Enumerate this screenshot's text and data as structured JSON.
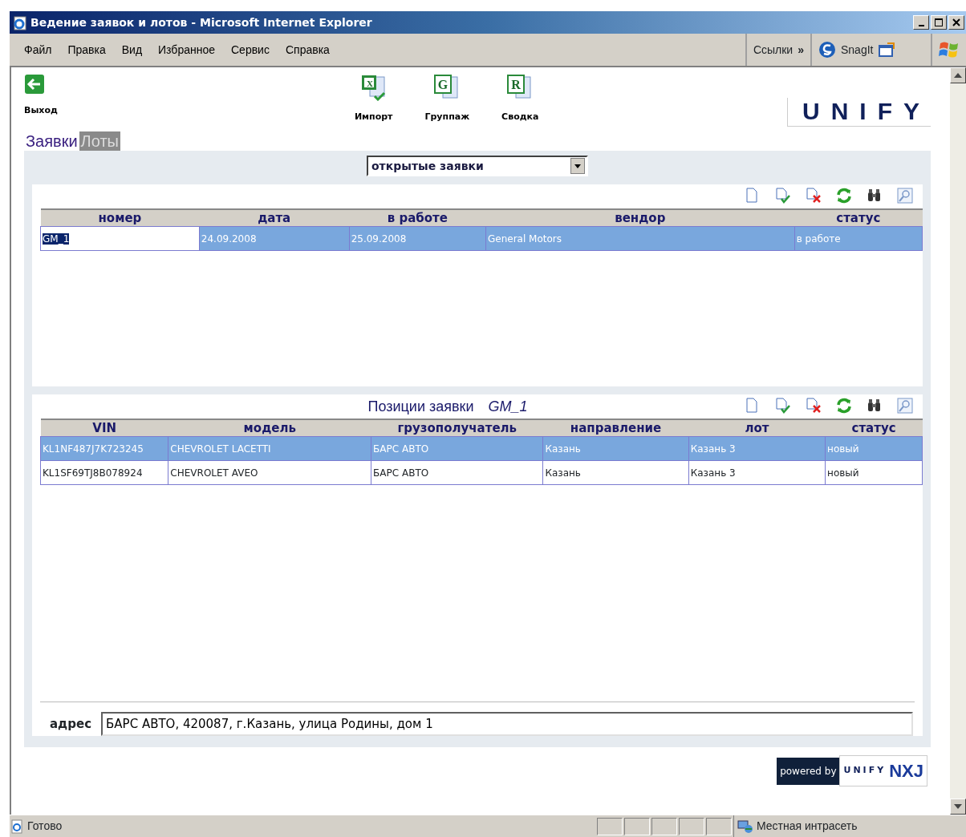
{
  "window": {
    "title": "Ведение заявок и лотов - Microsoft Internet Explorer"
  },
  "menu": [
    "Файл",
    "Правка",
    "Вид",
    "Избранное",
    "Сервис",
    "Справка"
  ],
  "links_bar": {
    "label": "Ссылки",
    "chevron": "»",
    "snagit": "SnagIt"
  },
  "exit_button": {
    "label": "Выход"
  },
  "toolbar": [
    {
      "kind": "excel",
      "label": "Импорт",
      "letter": "X"
    },
    {
      "kind": "doc",
      "label": "Группаж",
      "letter": "G"
    },
    {
      "kind": "doc",
      "label": "Сводка",
      "letter": "R"
    }
  ],
  "logo": "UNIFY",
  "tabs": [
    {
      "label": "Заявки",
      "selected": true
    },
    {
      "label": "Лоты",
      "selected": false
    }
  ],
  "filter": {
    "value": "открытые заявки"
  },
  "orders": {
    "columns": [
      "номер",
      "дата",
      "в работе",
      "вендор",
      "статус"
    ],
    "rows": [
      {
        "cells": [
          "GM_1",
          "24.09.2008",
          "25.09.2008",
          "General Motors",
          "в работе"
        ],
        "selected": true,
        "editing": true
      }
    ]
  },
  "positions": {
    "title": "Позиции заявки",
    "order_ref": "GM_1",
    "columns": [
      "VIN",
      "модель",
      "грузополучатель",
      "направление",
      "лот",
      "статус"
    ],
    "rows": [
      {
        "cells": [
          "KL1NF487J7K723245",
          "CHEVROLET LACETTI",
          "БАРС АВТО",
          "Казань",
          "Казань 3",
          "новый"
        ],
        "selected": true
      },
      {
        "cells": [
          "KL1SF69TJ8B078924",
          "CHEVROLET AVEO",
          "БАРС АВТО",
          "Казань",
          "Казань 3",
          "новый"
        ],
        "selected": false
      }
    ]
  },
  "address": {
    "label": "адрес",
    "value": "БАРС АВТО, 420087, г.Казань, улица Родины, дом 1"
  },
  "footer": {
    "powered": "powered by",
    "brand": "UNIFY",
    "product": "NXJ"
  },
  "status_bar": {
    "text": "Готово",
    "zone": "Местная интрасеть"
  }
}
